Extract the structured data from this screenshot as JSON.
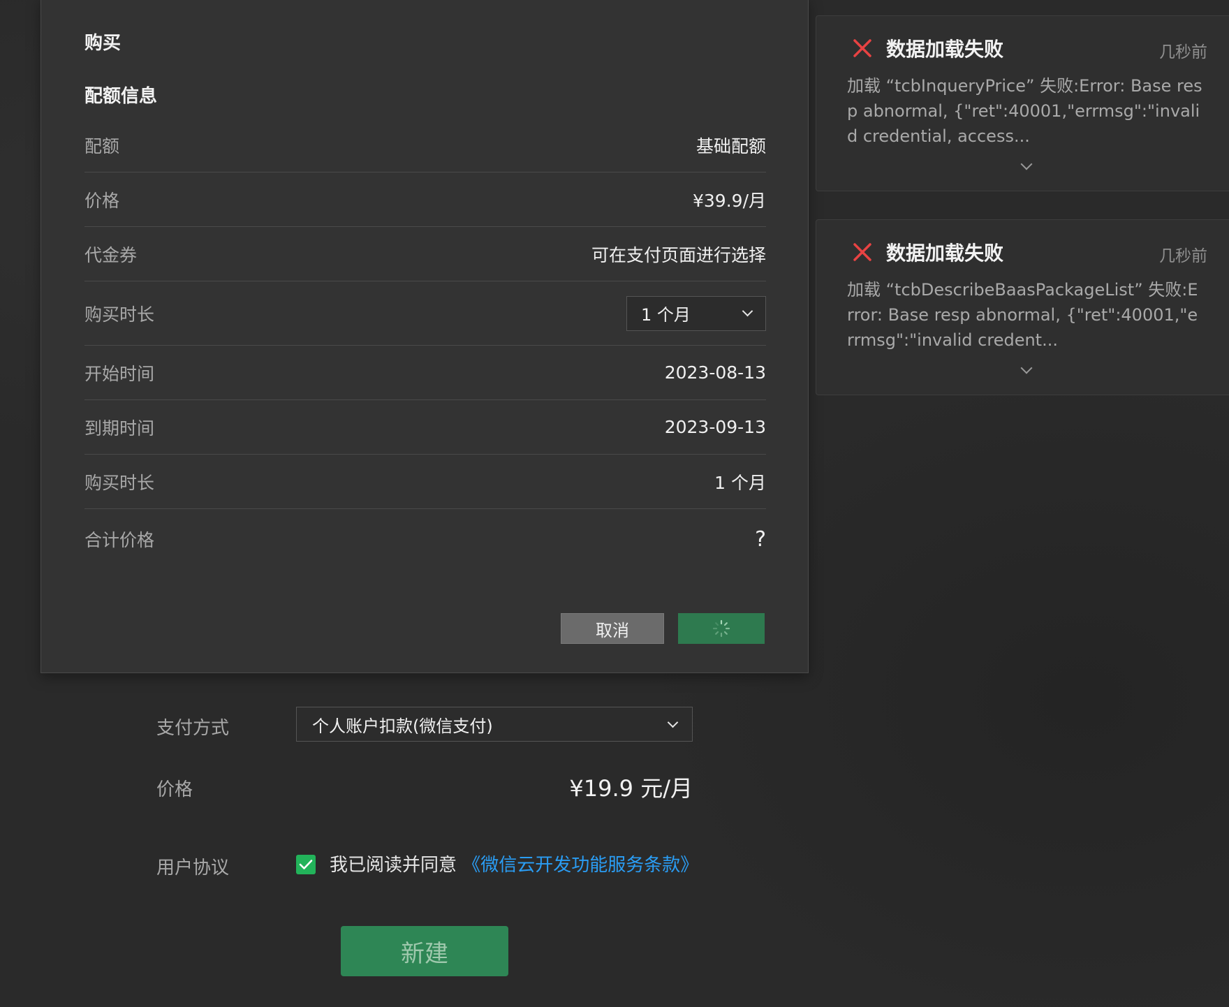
{
  "dialog": {
    "title": "购买",
    "section_title": "配额信息",
    "rows": [
      {
        "label": "配额",
        "value": "基础配额"
      },
      {
        "label": "价格",
        "value": "¥39.9/月"
      },
      {
        "label": "代金券",
        "value": "可在支付页面进行选择"
      },
      {
        "label": "购买时长",
        "value": "1 个月"
      },
      {
        "label": "开始时间",
        "value": "2023-08-13"
      },
      {
        "label": "到期时间",
        "value": "2023-09-13"
      },
      {
        "label": "购买时长",
        "value": "1 个月"
      },
      {
        "label": "合计价格",
        "value": "?"
      }
    ],
    "cancel_label": "取消"
  },
  "form": {
    "payment_label": "支付方式",
    "payment_value": "个人账户扣款(微信支付)",
    "price_label": "价格",
    "price_value": "¥19.9 元/月",
    "agreement_label": "用户协议",
    "agreement_text": "我已阅读并同意",
    "agreement_link": "《微信云开发功能服务条款》",
    "agreement_checked": true,
    "create_label": "新建"
  },
  "toasts": [
    {
      "title": "数据加载失败",
      "time": "几秒前",
      "message": "加载 “tcbInqueryPrice” 失败:Error: Base resp abnormal, {\"ret\":40001,\"errmsg\":\"invalid credential, access..."
    },
    {
      "title": "数据加载失败",
      "time": "几秒前",
      "message": "加载 “tcbDescribeBaasPackageList” 失败:Error: Base resp abnormal, {\"ret\":40001,\"errmsg\":\"invalid credent..."
    }
  ],
  "colors": {
    "accent_green": "#2e8655",
    "link_blue": "#2a9df4",
    "error_red": "#e84343",
    "checkbox_green": "#22b35a"
  }
}
